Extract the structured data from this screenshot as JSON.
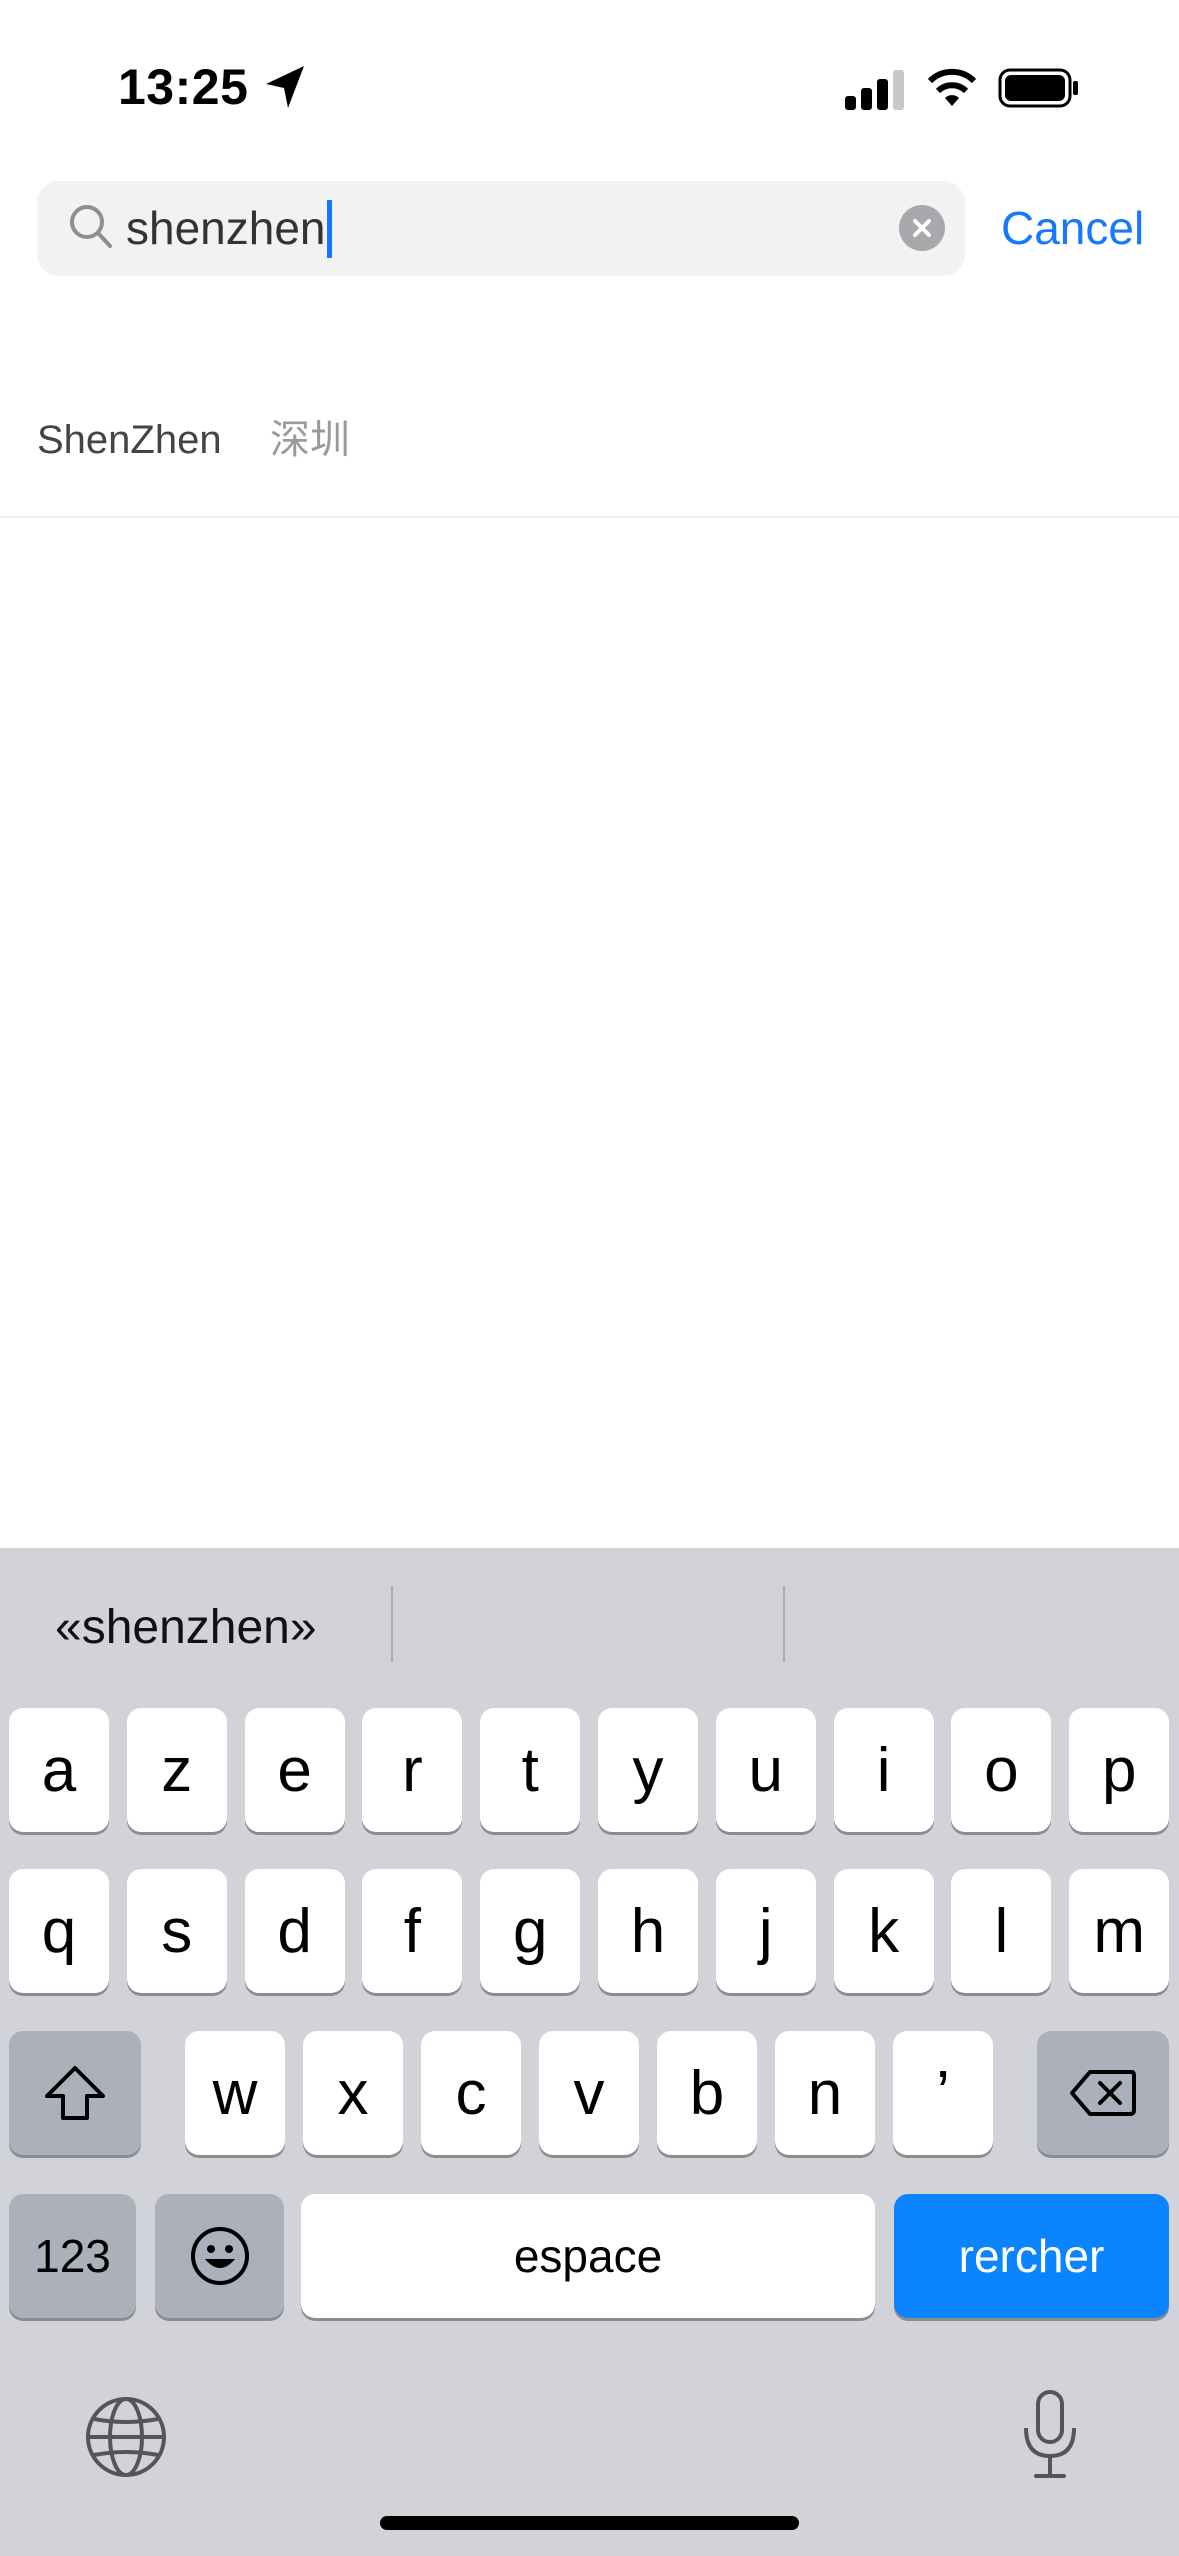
{
  "status_bar": {
    "time": "13:25"
  },
  "search": {
    "value": "shenzhen",
    "cancel_label": "Cancel"
  },
  "results": [
    {
      "name": "ShenZhen",
      "name_cn": "深圳"
    }
  ],
  "keyboard": {
    "suggestions": [
      "«shenzhen»",
      "",
      ""
    ],
    "row1": [
      "a",
      "z",
      "e",
      "r",
      "t",
      "y",
      "u",
      "i",
      "o",
      "p"
    ],
    "row2": [
      "q",
      "s",
      "d",
      "f",
      "g",
      "h",
      "j",
      "k",
      "l",
      "m"
    ],
    "row3": [
      "w",
      "x",
      "c",
      "v",
      "b",
      "n",
      "’"
    ],
    "numbers_label": "123",
    "space_label": "espace",
    "return_label": "rercher",
    "icons": [
      "shift-icon",
      "backspace-icon",
      "emoji-icon",
      "globe-icon",
      "microphone-icon"
    ],
    "colors": {
      "key": "#ffffff",
      "dark_key": "#abb0ba",
      "return_key": "#0a84ff",
      "background": "#d1d3d9"
    }
  },
  "accent_color": "#1677ff"
}
